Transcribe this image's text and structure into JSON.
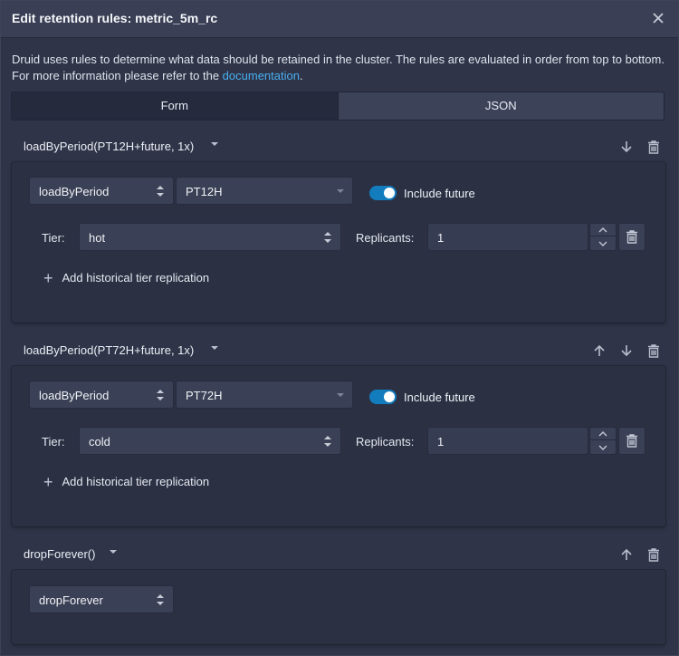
{
  "dialog": {
    "title": "Edit retention rules: metric_5m_rc",
    "description_text": "Druid uses rules to determine what data should be retained in the cluster. The rules are evaluated in order from top to bottom. For more information please refer to the ",
    "doc_link": "documentation",
    "description_end": "."
  },
  "tabs": [
    {
      "label": "Form",
      "active": true
    },
    {
      "label": "JSON",
      "active": false
    }
  ],
  "rules": [
    {
      "title": "loadByPeriod(PT12H+future, 1x)",
      "type": "loadByPeriod",
      "period": "PT12H",
      "include_future_label": "Include future",
      "include_future": true,
      "tier_label": "Tier:",
      "tier": "hot",
      "replicants_label": "Replicants:",
      "replicants": "1",
      "add_label": "Add historical tier replication"
    },
    {
      "title": "loadByPeriod(PT72H+future, 1x)",
      "type": "loadByPeriod",
      "period": "PT72H",
      "include_future_label": "Include future",
      "include_future": true,
      "tier_label": "Tier:",
      "tier": "cold",
      "replicants_label": "Replicants:",
      "replicants": "1",
      "add_label": "Add historical tier replication"
    },
    {
      "title": "dropForever()",
      "type": "dropForever"
    }
  ],
  "icons": {
    "close": "close-icon",
    "move_up": "arrow-up-icon",
    "move_down": "arrow-down-icon",
    "delete": "trash-icon",
    "caret": "caret-down-icon",
    "stepper_up": "chevron-up-icon",
    "stepper_down": "chevron-down-icon",
    "add": "plus-icon"
  },
  "colors": {
    "accent": "#137cbd",
    "link": "#48aff0",
    "background": "#2f3448",
    "card": "#2b3043"
  }
}
